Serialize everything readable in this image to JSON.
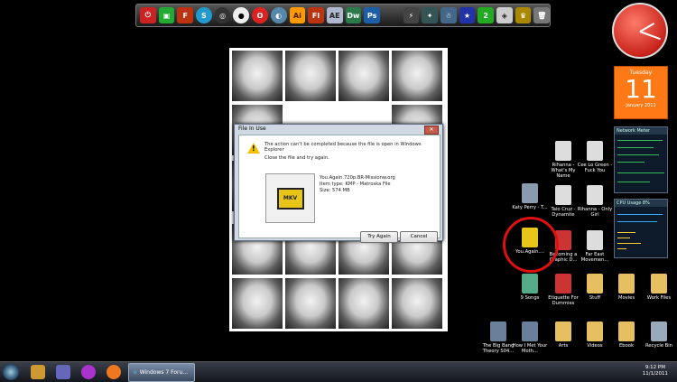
{
  "dock": {
    "icons": [
      "power-icon",
      "gift-icon",
      "filezilla-icon",
      "skype-icon",
      "steam-icon",
      "media-player-icon",
      "opera-icon",
      "utility-icon",
      "illustrator-icon",
      "flash-icon",
      "after-effects-icon",
      "dreamweaver-icon",
      "photoshop-icon",
      "spacer",
      "game-icon-1",
      "game-icon-2",
      "game-icon-3",
      "game-icon-4",
      "game-icon-5",
      "game-icon-6",
      "game-icon-7",
      "recycle-bin-icon"
    ],
    "labels": {
      "ai": "Ai",
      "fl": "Fl",
      "ae": "AE",
      "dw": "Dw",
      "ps": "Ps"
    }
  },
  "dialog": {
    "title": "File In Use",
    "close": "✕",
    "message": "The action can't be completed because the file is open in Windows Explorer",
    "instruction": "Close the file and try again.",
    "file_name": "You.Again.720p.BR-Missionw.org",
    "item_type": "Item type: KMP - Matroska File",
    "size": "Size: 574 MB",
    "thumb_label": "MKV",
    "try_again": "Try Again",
    "cancel": "Cancel"
  },
  "calendar": {
    "day": "Tuesday",
    "date": "11",
    "month": "January 2011"
  },
  "gadgets": {
    "network_title": "Network Meter",
    "cpu_title": "CPU Usage  8%"
  },
  "desktop_icons": [
    {
      "label": "Rihanna - What's My Name",
      "color": "#ddd"
    },
    {
      "label": "Cee Lo Green - Fuck You",
      "color": "#ddd"
    },
    {
      "label": "Katy Perry - T...",
      "color": "#8a9bb0"
    },
    {
      "label": "Taio Cruz - Dynamite",
      "color": "#ddd"
    },
    {
      "label": "Rihanna - Only Girl",
      "color": "#ddd"
    },
    {
      "label": "You.Again....",
      "color": "#e8c619"
    },
    {
      "label": "Becoming a Graphic D...",
      "color": "#c33"
    },
    {
      "label": "Far East Movemen...",
      "color": "#ddd"
    },
    {
      "label": "9 Songs",
      "color": "#5a8"
    },
    {
      "label": "Etiquette For Dummies",
      "color": "#c33"
    },
    {
      "label": "Stuff",
      "color": "#e6c060"
    },
    {
      "label": "Movies",
      "color": "#e6c060"
    },
    {
      "label": "Work Files",
      "color": "#e6c060"
    },
    {
      "label": "The Big Bang Theory S04...",
      "color": "#6a7f9a"
    },
    {
      "label": "How I Met Your Moth...",
      "color": "#6a7f9a"
    },
    {
      "label": "Arts",
      "color": "#e6c060"
    },
    {
      "label": "Videos",
      "color": "#e6c060"
    },
    {
      "label": "Ebook",
      "color": "#e6c060"
    },
    {
      "label": "Recycle Bin",
      "color": "#9ab"
    }
  ],
  "taskbar": {
    "task_label": "Windows 7 Foru...",
    "time": "9:12 PM",
    "date": "11/1/2011"
  }
}
